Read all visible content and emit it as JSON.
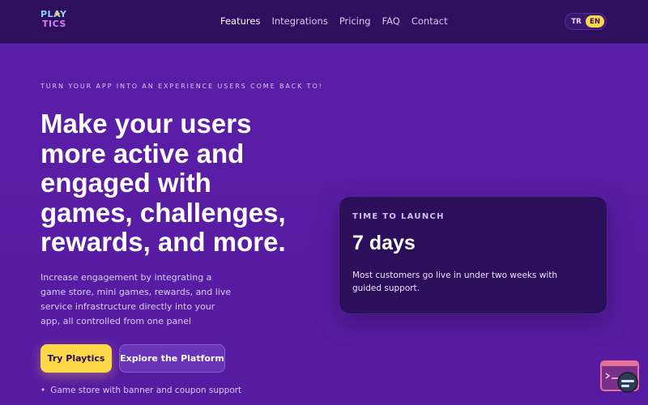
{
  "header": {
    "logo_line1": "PLAY",
    "logo_line2": "TICS",
    "nav": [
      {
        "label": "Features",
        "active": true
      },
      {
        "label": "Integrations",
        "active": false
      },
      {
        "label": "Pricing",
        "active": false
      },
      {
        "label": "FAQ",
        "active": false
      },
      {
        "label": "Contact",
        "active": false
      }
    ],
    "lang": {
      "tr": "TR",
      "en": "EN",
      "selected": "EN"
    }
  },
  "hero": {
    "eyebrow": "TURN YOUR APP INTO AN EXPERIENCE USERS COME BACK TO!",
    "headline": "Make your users more active and engaged with games, challenges, rewards, and more.",
    "subtext": "Increase engagement by integrating a game store, mini games, rewards, and live service infrastructure directly into your app, all controlled from one panel",
    "primary_cta": "Try Playtics",
    "secondary_cta": "Explore the Platform",
    "bullets": [
      "Game store with banner and coupon support"
    ]
  },
  "card": {
    "kicker": "TIME TO LAUNCH",
    "value": "7 days",
    "text": "Most customers go live in under two weeks with guided support."
  },
  "colors": {
    "background": "#5a1fa8",
    "topbar": "#2e0f5e",
    "accent": "#ffd84a",
    "card": "#2b0f5a"
  },
  "icons": {
    "widget": "chat-widget-icon"
  }
}
